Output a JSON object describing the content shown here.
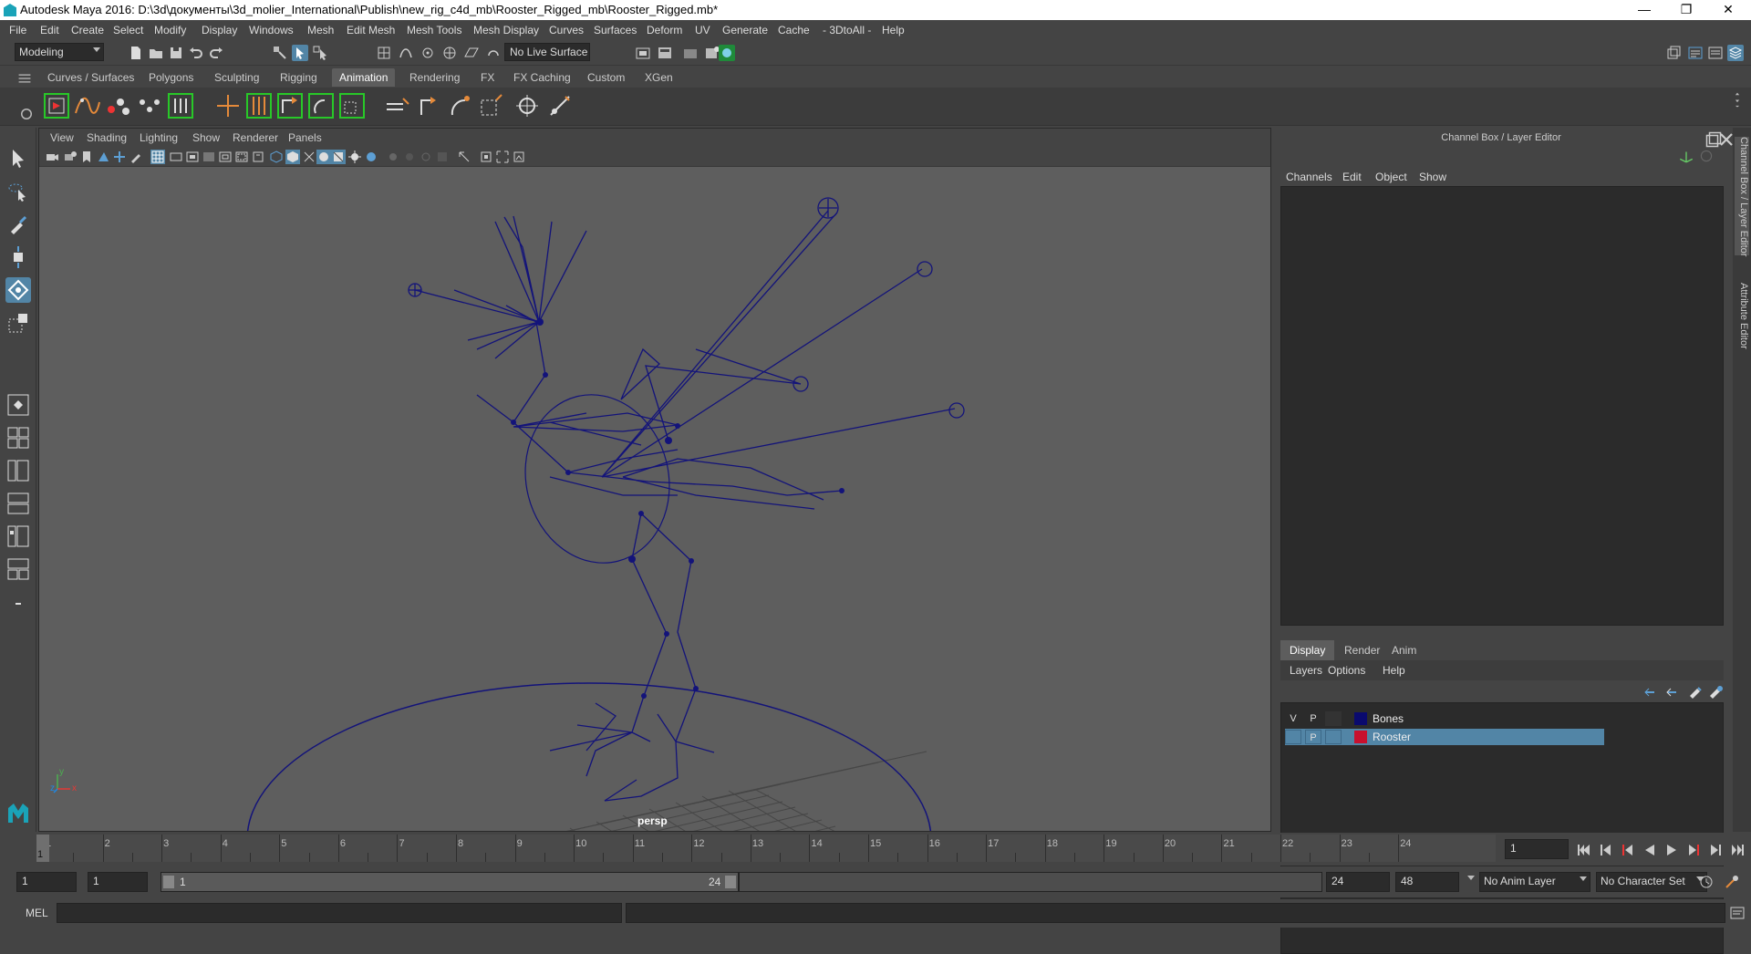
{
  "window": {
    "title": "Autodesk Maya 2016: D:\\3d\\документы\\3d_molier_International\\Publish\\new_rig_c4d_mb\\Rooster_Rigged_mb\\Rooster_Rigged.mb*",
    "minimize": "—",
    "maximize": "❐",
    "close": "✕"
  },
  "menubar": [
    "File",
    "Edit",
    "Create",
    "Select",
    "Modify",
    "Display",
    "Windows",
    "Mesh",
    "Edit Mesh",
    "Mesh Tools",
    "Mesh Display",
    "Curves",
    "Surfaces",
    "Deform",
    "UV",
    "Generate",
    "Cache",
    "- 3DtoAll -",
    "Help"
  ],
  "statusline": {
    "mode": "Modeling",
    "live_surface": "No Live Surface"
  },
  "shelf_tabs": [
    "Curves / Surfaces",
    "Polygons",
    "Sculpting",
    "Rigging",
    "Animation",
    "Rendering",
    "FX",
    "FX Caching",
    "Custom",
    "XGen"
  ],
  "shelf_active": "Animation",
  "viewport": {
    "menu": [
      "View",
      "Shading",
      "Lighting",
      "Show",
      "Renderer",
      "Panels"
    ],
    "camera_label": "persp",
    "axis_x": "x",
    "axis_y": "y",
    "axis_z": "z"
  },
  "channel_box": {
    "title": "Channel Box / Layer Editor",
    "menu": [
      "Channels",
      "Edit",
      "Object",
      "Show"
    ]
  },
  "layer_editor": {
    "tabs": [
      "Display",
      "Render",
      "Anim"
    ],
    "active_tab": "Display",
    "menu": [
      "Layers",
      "Options",
      "Help"
    ],
    "header_v": "V",
    "header_p": "P",
    "layers": [
      {
        "v": "",
        "p": "",
        "name": "Bones",
        "color": "#0a0a6e",
        "selected": false
      },
      {
        "v": "",
        "p": "P",
        "name": "Rooster",
        "color": "#c8102e",
        "selected": true
      }
    ]
  },
  "side_tabs": [
    "Channel Box / Layer Editor",
    "Attribute Editor"
  ],
  "timeline": {
    "ticks": [
      "1",
      "2",
      "3",
      "4",
      "5",
      "6",
      "7",
      "8",
      "9",
      "10",
      "11",
      "12",
      "13",
      "14",
      "15",
      "16",
      "17",
      "18",
      "19",
      "20",
      "21",
      "22",
      "23",
      "24"
    ],
    "current_frame_marker": "1",
    "current_frame_field": "1"
  },
  "range": {
    "start": "1",
    "playback_start": "1",
    "slider_start": "1",
    "slider_end": "24",
    "playback_end": "24",
    "end": "48",
    "anim_layer": "No Anim Layer",
    "character_set": "No Character Set"
  },
  "command_line": {
    "label": "MEL"
  },
  "colors": {
    "accent": "#5285a6",
    "rig": "#13137a",
    "grid": "#4a4a4a"
  }
}
